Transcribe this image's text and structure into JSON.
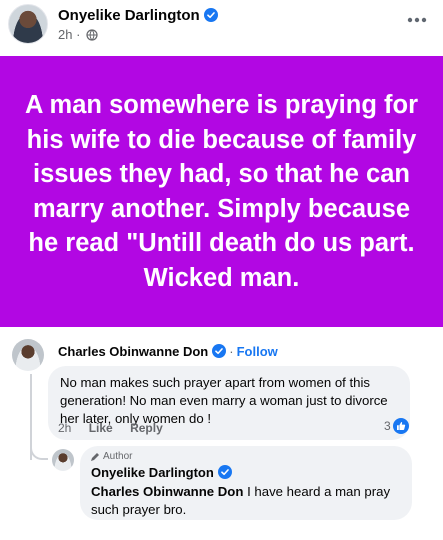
{
  "post": {
    "author": "Onyelike Darlington",
    "time": "2h",
    "body": "A man somewhere is praying for his wife to die because of family issues they had, so that he can marry another. Simply because he read \"Untill death do us part. Wicked man.",
    "background_color": "#b207e3"
  },
  "comment": {
    "author": "Charles Obinwanne Don",
    "separator": "·",
    "follow_label": "Follow",
    "text": "No man makes such prayer apart from women of this generation! No man even marry a woman just to divorce her later, only women do !",
    "time": "2h",
    "like_label": "Like",
    "reply_label": "Reply",
    "reaction_count": "3"
  },
  "reply": {
    "badge": "Author",
    "author": "Onyelike Darlington",
    "mention": "Charles Obinwanne Don",
    "text": " I have heard a man pray such prayer bro."
  },
  "colors": {
    "accent": "#1877f2",
    "secondary_text": "#65676b",
    "bubble": "#f0f2f5"
  },
  "icons": [
    "verified-badge-icon",
    "globe-icon",
    "more-options-icon",
    "like-icon",
    "author-badge-icon"
  ]
}
